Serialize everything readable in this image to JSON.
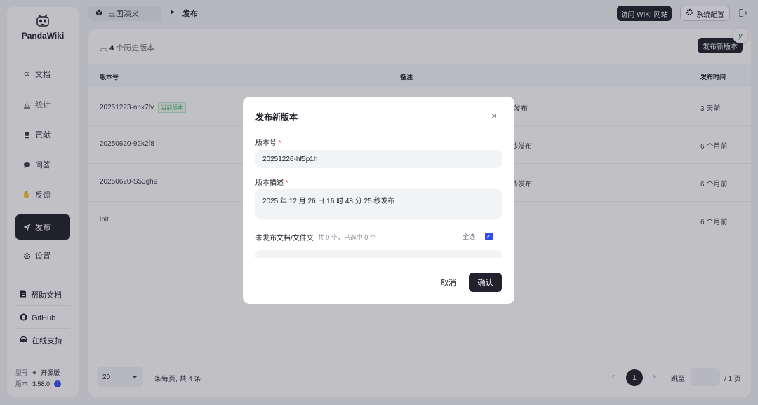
{
  "sidebar": {
    "app_name": "PandaWiki",
    "nav": [
      {
        "label": "文档",
        "icon": "layers-icon"
      },
      {
        "label": "统计",
        "icon": "bar-chart-icon"
      },
      {
        "label": "贡献",
        "icon": "trophy-icon"
      },
      {
        "label": "问答",
        "icon": "chat-bubble-icon"
      },
      {
        "label": "反馈",
        "icon": "hand-icon"
      },
      {
        "label": "发布",
        "icon": "paper-plane-icon"
      },
      {
        "label": "设置",
        "icon": "gear-icon"
      }
    ],
    "active_nav": "发布",
    "links": [
      {
        "label": "帮助文档",
        "icon": "document-icon"
      },
      {
        "label": "GitHub",
        "icon": "github-icon"
      },
      {
        "label": "在线支持",
        "icon": "support-icon"
      }
    ],
    "model_label": "型号",
    "model_value": "开源版",
    "version_label": "版本",
    "version_value": "3.58.0",
    "version_badge": "!"
  },
  "header": {
    "wiki_name": "三国演义",
    "current_page": "发布",
    "visit_button": "访问 WIKI 网站",
    "config_button": "系统配置"
  },
  "main": {
    "count_prefix": "共",
    "count_value": "4",
    "count_suffix": "个历史版本",
    "new_version_button": "发布新版本",
    "columns": {
      "version": "版本号",
      "remark": "备注",
      "time": "发布时间"
    },
    "rows": [
      {
        "version": "20251223-nnx7fv",
        "tag": "当前版本",
        "remark": "发布",
        "time": "3 天前"
      },
      {
        "version": "20250620-92k2f8",
        "tag": "",
        "remark": "秒发布",
        "time": "6 个月前"
      },
      {
        "version": "20250620-S53gh9",
        "tag": "",
        "remark": "秒发布",
        "time": "6 个月前"
      },
      {
        "version": "init",
        "tag": "",
        "remark": "",
        "time": "6 个月前"
      }
    ],
    "pager": {
      "page_size": "20",
      "page_size_suffix": "条每页, 共 4 条",
      "current_page": "1",
      "jump_label": "跳至",
      "total_pages": "/ 1 页"
    }
  },
  "modal": {
    "title": "发布新版本",
    "version_label": "版本号",
    "version_value": "20251226-hf5p1h",
    "desc_label": "版本描述",
    "desc_value": "2025 年 12 月 26 日 16 时 48 分 25 秒发布",
    "unpublished_label": "未发布文档/文件夹",
    "unpublished_count": "共 0 个，已选中 0 个",
    "select_all": "全选",
    "select_all_checked": true,
    "cancel": "取消",
    "confirm": "确认"
  }
}
